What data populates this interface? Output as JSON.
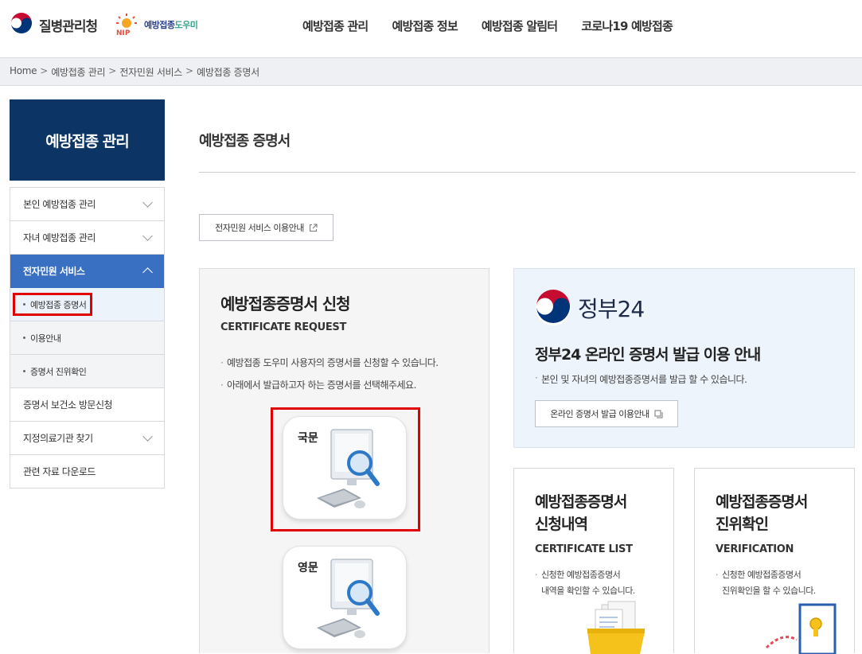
{
  "header": {
    "agency_name": "질병관리청",
    "partner_name_a": "예방접종",
    "partner_name_b": "도우미",
    "nav": [
      "예방접종 관리",
      "예방접종 정보",
      "예방접종 알림터",
      "코로나19 예방접종"
    ]
  },
  "breadcrumb": {
    "items": [
      "Home",
      "예방접종 관리",
      "전자민원 서비스",
      "예방접종 증명서"
    ],
    "separator": ">"
  },
  "sidebar": {
    "title": "예방접종 관리",
    "items": [
      {
        "label": "본인 예방접종 관리",
        "has_chevron": true
      },
      {
        "label": "자녀 예방접종 관리",
        "has_chevron": true
      },
      {
        "label": "전자민원 서비스",
        "has_chevron": true,
        "active": true
      },
      {
        "label": "예방접종 증명서",
        "sub": true,
        "current": true
      },
      {
        "label": "이용안내",
        "sub": true
      },
      {
        "label": "증명서 진위확인",
        "sub": true
      },
      {
        "label": "증명서 보건소 방문신청",
        "has_chevron": false
      },
      {
        "label": "지정의료기관 찾기",
        "has_chevron": true
      },
      {
        "label": "관련 자료 다운로드",
        "has_chevron": false
      }
    ]
  },
  "main": {
    "title": "예방접종 증명서",
    "guide_button": "전자민원 서비스 이용안내",
    "request": {
      "title": "예방접종증명서 신청",
      "subtitle": "CERTIFICATE REQUEST",
      "desc": [
        "예방접종 도우미 사용자의 증명서를 신청할 수 있습니다.",
        "아래에서 발급하고자 하는 증명서를 선택해주세요."
      ],
      "korean_label": "국문",
      "english_label": "영문"
    },
    "gov24": {
      "logo_text": "정부24",
      "title": "정부24 온라인 증명서 발급 이용 안내",
      "desc": "본인 및 자녀의 예방접종증명서를 발급 할 수 있습니다.",
      "button": "온라인 증명서 발급 이용안내"
    },
    "list_card": {
      "title_line1": "예방접종증명서",
      "title_line2": "신청내역",
      "subtitle": "CERTIFICATE LIST",
      "desc_line1": "신청한 예방접종증명서",
      "desc_line2": "내역을 확인할 수 있습니다."
    },
    "verify_card": {
      "title_line1": "예방접종증명서",
      "title_line2": "진위확인",
      "subtitle": "VERIFICATION",
      "desc_line1": "신청한 예방접종증명서",
      "desc_line2": "진위확인을 할 수 있습니다."
    }
  },
  "colors": {
    "navy": "#0c3566",
    "active_blue": "#3970c1",
    "highlight_red": "#e00000",
    "gov_panel_bg": "#eef4fb"
  }
}
